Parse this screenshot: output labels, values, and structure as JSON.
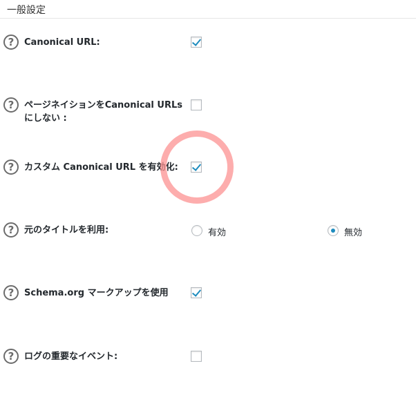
{
  "section": {
    "title": "一般設定"
  },
  "icons": {
    "help": "?"
  },
  "settings": {
    "canonical_url": {
      "label": "Canonical URL:",
      "checked": true
    },
    "no_pagination_canonical": {
      "label": "ページネイションをCanonical URLsにしない :",
      "checked": false
    },
    "custom_canonical": {
      "label": "カスタム Canonical URL を有効化:",
      "checked": true
    },
    "original_title": {
      "label": "元のタイトルを利用:",
      "options": [
        {
          "label": "有効",
          "selected": false
        },
        {
          "label": "無効",
          "selected": true
        }
      ]
    },
    "schema_markup": {
      "label": "Schema.org マークアップを使用",
      "checked": true
    },
    "log_events": {
      "label": "ログの重要なイベント:",
      "checked": false
    }
  },
  "colors": {
    "accent": "#1e8cbe",
    "highlight": "#fc9191"
  }
}
